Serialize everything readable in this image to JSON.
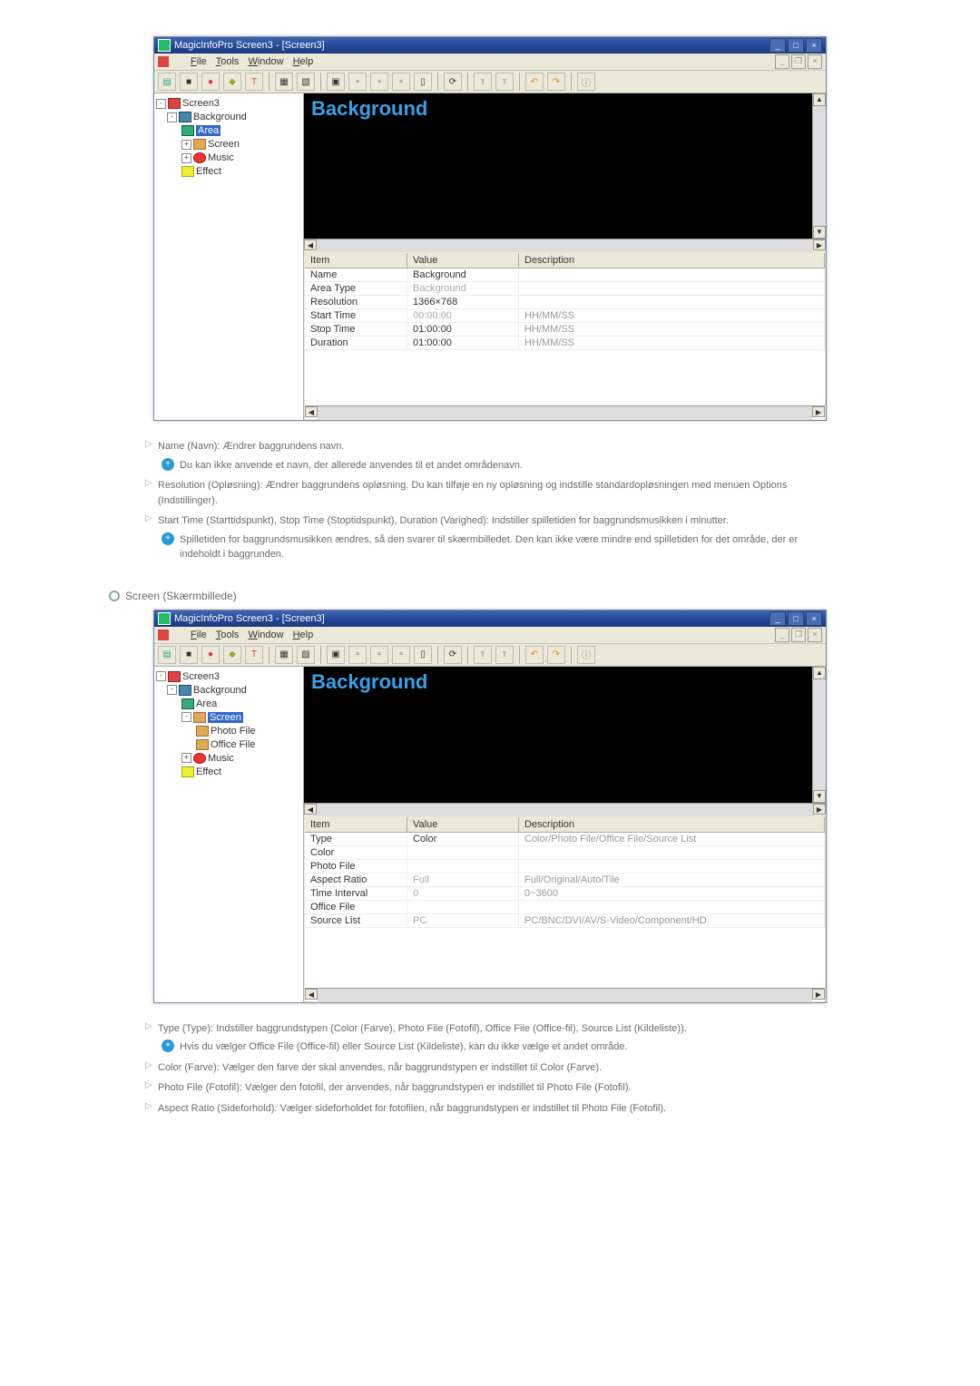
{
  "app": {
    "title": "MagicInfoPro Screen3 - [Screen3]",
    "menu": {
      "file": "File",
      "tools": "Tools",
      "window": "Window",
      "help": "Help"
    }
  },
  "tree1": {
    "root": "Screen3",
    "background": "Background",
    "area": "Area",
    "screen": "Screen",
    "music": "Music",
    "effect": "Effect"
  },
  "tree2": {
    "root": "Screen3",
    "background": "Background",
    "area": "Area",
    "screen": "Screen",
    "photo": "Photo File",
    "office": "Office File",
    "music": "Music",
    "effect": "Effect"
  },
  "preview": {
    "label": "Background"
  },
  "prop_headers": {
    "item": "Item",
    "value": "Value",
    "desc": "Description"
  },
  "chart_data": [
    {
      "type": "table",
      "title": "Background Area Properties",
      "rows": [
        {
          "item": "Name",
          "value": "Background",
          "desc": ""
        },
        {
          "item": "Area Type",
          "value": "Background",
          "desc": ""
        },
        {
          "item": "Resolution",
          "value": "1366×768",
          "desc": ""
        },
        {
          "item": "Start Time",
          "value": "00:00:00",
          "desc": "HH/MM/SS"
        },
        {
          "item": "Stop Time",
          "value": "01:00:00",
          "desc": "HH/MM/SS"
        },
        {
          "item": "Duration",
          "value": "01:00:00",
          "desc": "HH/MM/SS"
        }
      ]
    },
    {
      "type": "table",
      "title": "Screen Properties",
      "rows": [
        {
          "item": "Type",
          "value": "Color",
          "desc": "Color/Photo File/Office File/Source List"
        },
        {
          "item": "Color",
          "value": "",
          "desc": ""
        },
        {
          "item": "Photo File",
          "value": "",
          "desc": ""
        },
        {
          "item": "Aspect Ratio",
          "value": "Full",
          "desc": "Full/Original/Auto/Tile"
        },
        {
          "item": "Time Interval",
          "value": "0",
          "desc": "0~3600"
        },
        {
          "item": "Office File",
          "value": "",
          "desc": ""
        },
        {
          "item": "Source List",
          "value": "PC",
          "desc": "PC/BNC/DVI/AV/S-Video/Component/HD"
        }
      ]
    }
  ],
  "doc1": {
    "name": "Name (Navn): Ændrer baggrundens navn.",
    "name_note": "Du kan ikke anvende et navn, der allerede anvendes til et andet områdenavn.",
    "resolution": "Resolution (Opløsning): Ændrer baggrundens opløsning. Du kan tilføje en ny opløsning og indstille standardopløsningen med menuen Options (Indstillinger).",
    "time": "Start Time (Starttidspunkt), Stop Time (Stoptidspunkt), Duration (Varighed): Indstiller spilletiden for baggrundsmusikken i minutter.",
    "time_note": "Spilletiden for baggrundsmusikken ændres, så den svarer til skærmbilledet. Den kan ikke være mindre end spilletiden for det område, der er indeholdt i baggrunden."
  },
  "section2": "Screen (Skærmbillede)",
  "doc2": {
    "type": "Type (Type): Indstiller baggrundstypen (Color (Farve), Photo File (Fotofil), Office File (Office-fil), Source List (Kildeliste)).",
    "type_note": "Hvis du vælger Office File (Office-fil) eller Source List (Kildeliste), kan du ikke vælge et andet område.",
    "color": "Color (Farve): Vælger den farve der skal anvendes, når baggrundstypen er indstillet til Color (Farve).",
    "photo": "Photo File (Fotofil): Vælger den fotofil, der anvendes, når baggrundstypen er indstillet til Photo File (Fotofil).",
    "aspect": "Aspect Ratio (Sideforhold): Vælger sideforholdet for fotofilen, når baggrundstypen er indstillet til Photo File (Fotofil)."
  }
}
